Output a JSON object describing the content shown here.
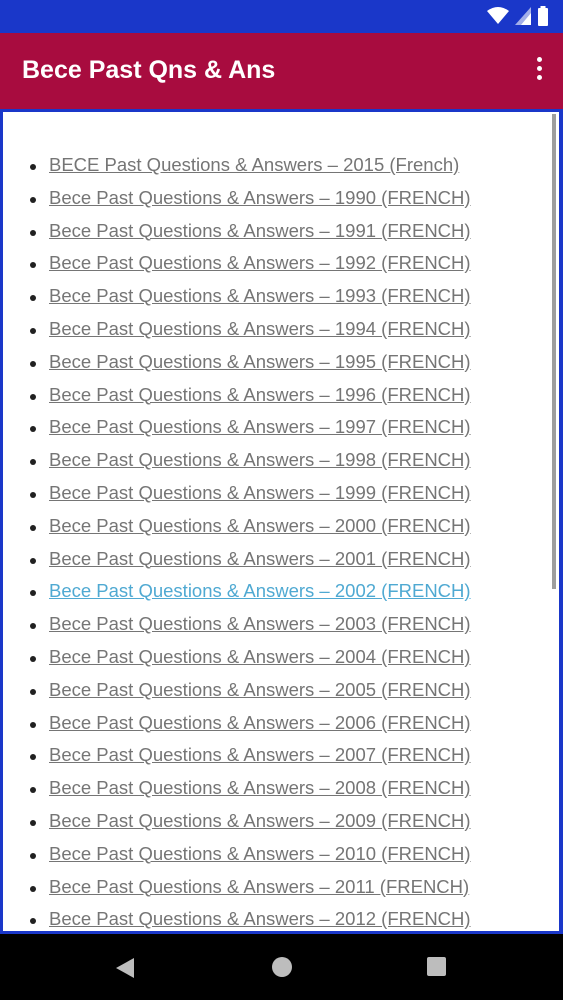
{
  "app_bar": {
    "title": "Bece Past Qns & Ans",
    "overflow_icon": "more-vert-icon"
  },
  "colors": {
    "status_bar": "#1a37c9",
    "app_bar": "#a80c3f",
    "link": "#757575",
    "link_active": "#4fa9d2"
  },
  "links": [
    {
      "label": "BECE Past Questions & Answers – 2015 (French)",
      "active": false
    },
    {
      "label": "Bece Past Questions & Answers – 1990 (FRENCH)",
      "active": false
    },
    {
      "label": "Bece Past Questions & Answers – 1991 (FRENCH)",
      "active": false
    },
    {
      "label": "Bece Past Questions & Answers – 1992 (FRENCH)",
      "active": false
    },
    {
      "label": "Bece Past Questions & Answers – 1993 (FRENCH)",
      "active": false
    },
    {
      "label": "Bece Past Questions & Answers – 1994 (FRENCH)",
      "active": false
    },
    {
      "label": "Bece Past Questions & Answers – 1995 (FRENCH)",
      "active": false
    },
    {
      "label": "Bece Past Questions & Answers – 1996 (FRENCH)",
      "active": false
    },
    {
      "label": "Bece Past Questions & Answers – 1997 (FRENCH)",
      "active": false
    },
    {
      "label": "Bece Past Questions & Answers – 1998 (FRENCH)",
      "active": false
    },
    {
      "label": "Bece Past Questions & Answers – 1999 (FRENCH)",
      "active": false
    },
    {
      "label": "Bece Past Questions & Answers – 2000 (FRENCH)",
      "active": false
    },
    {
      "label": "Bece Past Questions & Answers – 2001 (FRENCH)",
      "active": false
    },
    {
      "label": "Bece Past Questions & Answers – 2002 (FRENCH)",
      "active": true
    },
    {
      "label": "Bece Past Questions & Answers – 2003 (FRENCH)",
      "active": false
    },
    {
      "label": "Bece Past Questions & Answers – 2004 (FRENCH)",
      "active": false
    },
    {
      "label": "Bece Past Questions & Answers – 2005 (FRENCH)",
      "active": false
    },
    {
      "label": "Bece Past Questions & Answers – 2006 (FRENCH)",
      "active": false
    },
    {
      "label": "Bece Past Questions & Answers – 2007 (FRENCH)",
      "active": false
    },
    {
      "label": "Bece Past Questions & Answers – 2008 (FRENCH)",
      "active": false
    },
    {
      "label": "Bece Past Questions & Answers – 2009 (FRENCH)",
      "active": false
    },
    {
      "label": "Bece Past Questions & Answers – 2010 (FRENCH)",
      "active": false
    },
    {
      "label": "Bece Past Questions & Answers – 2011 (FRENCH)",
      "active": false
    },
    {
      "label": "Bece Past Questions & Answers – 2012 (FRENCH)",
      "active": false
    }
  ],
  "status_icons": [
    "wifi-icon",
    "cell-signal-icon",
    "battery-icon"
  ],
  "nav_icons": [
    "back-icon",
    "home-icon",
    "recents-icon"
  ]
}
